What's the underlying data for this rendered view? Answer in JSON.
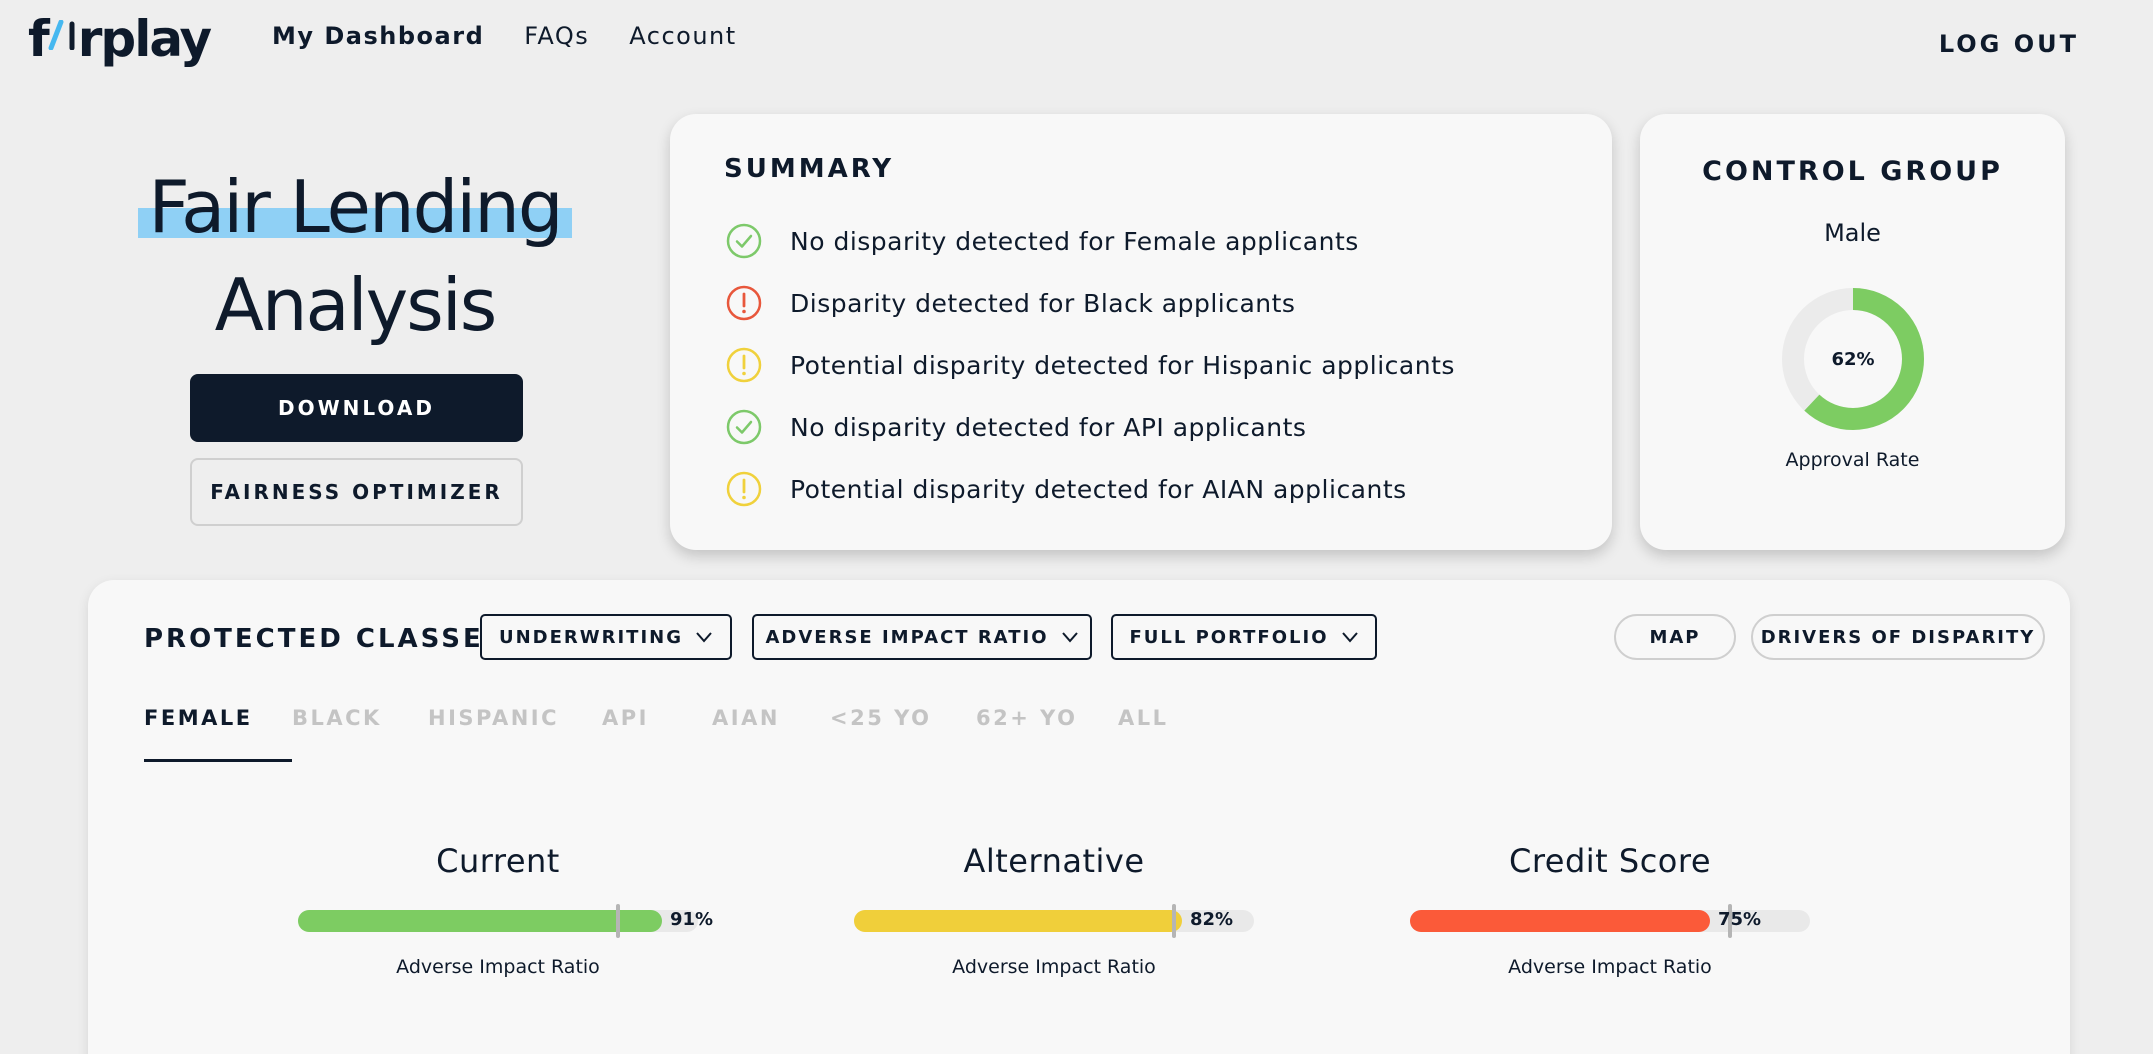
{
  "brand": {
    "logo_prefix": "f",
    "logo_suffix": "rplay"
  },
  "nav": {
    "items": [
      {
        "label": "My Dashboard",
        "active": true
      },
      {
        "label": "FAQs",
        "active": false
      },
      {
        "label": "Account",
        "active": false
      }
    ],
    "logout_label": "LOG OUT"
  },
  "hero": {
    "title_line1": "Fair Lending",
    "title_line2": "Analysis",
    "download_label": "DOWNLOAD",
    "fairness_label": "FAIRNESS OPTIMIZER",
    "highlight_color": "#8fd0f5"
  },
  "summary": {
    "title": "SUMMARY",
    "items": [
      {
        "status": "ok",
        "text": "No disparity detected for Female applicants"
      },
      {
        "status": "alert",
        "text": "Disparity detected for Black applicants"
      },
      {
        "status": "warning",
        "text": "Potential disparity detected for Hispanic applicants"
      },
      {
        "status": "ok",
        "text": "No disparity detected for API applicants"
      },
      {
        "status": "warning",
        "text": "Potential disparity detected for AIAN applicants"
      }
    ],
    "status_colors": {
      "ok": "#7dc96a",
      "alert": "#e8573c",
      "warning": "#f0d13c"
    }
  },
  "control_group": {
    "title": "CONTROL GROUP",
    "group": "Male",
    "approval_rate": 62,
    "approval_rate_label": "62%",
    "caption": "Approval Rate",
    "color": "#7dcc62",
    "track_color": "#ebebeb"
  },
  "protected": {
    "title": "PROTECTED CLASSES",
    "dropdowns": [
      {
        "label": "UNDERWRITING"
      },
      {
        "label": "ADVERSE IMPACT RATIO"
      },
      {
        "label": "FULL PORTFOLIO"
      }
    ],
    "map_label": "MAP",
    "drivers_label": "DRIVERS OF DISPARITY",
    "tabs": [
      {
        "label": "FEMALE",
        "active": true
      },
      {
        "label": "BLACK",
        "active": false
      },
      {
        "label": "HISPANIC",
        "active": false
      },
      {
        "label": "API",
        "active": false
      },
      {
        "label": "AIAN",
        "active": false
      },
      {
        "label": "<25 YO",
        "active": false
      },
      {
        "label": "62+ YO",
        "active": false
      },
      {
        "label": "ALL",
        "active": false
      }
    ],
    "metrics": [
      {
        "title": "Current",
        "value": 91,
        "value_label": "91%",
        "threshold": 80,
        "caption": "Adverse Impact Ratio",
        "color": "#7dcc62"
      },
      {
        "title": "Alternative",
        "value": 82,
        "value_label": "82%",
        "threshold": 80,
        "caption": "Adverse Impact Ratio",
        "color": "#f0cf3a"
      },
      {
        "title": "Credit Score",
        "value": 75,
        "value_label": "75%",
        "threshold": 80,
        "caption": "Adverse Impact Ratio",
        "color": "#fb5a39"
      }
    ]
  }
}
